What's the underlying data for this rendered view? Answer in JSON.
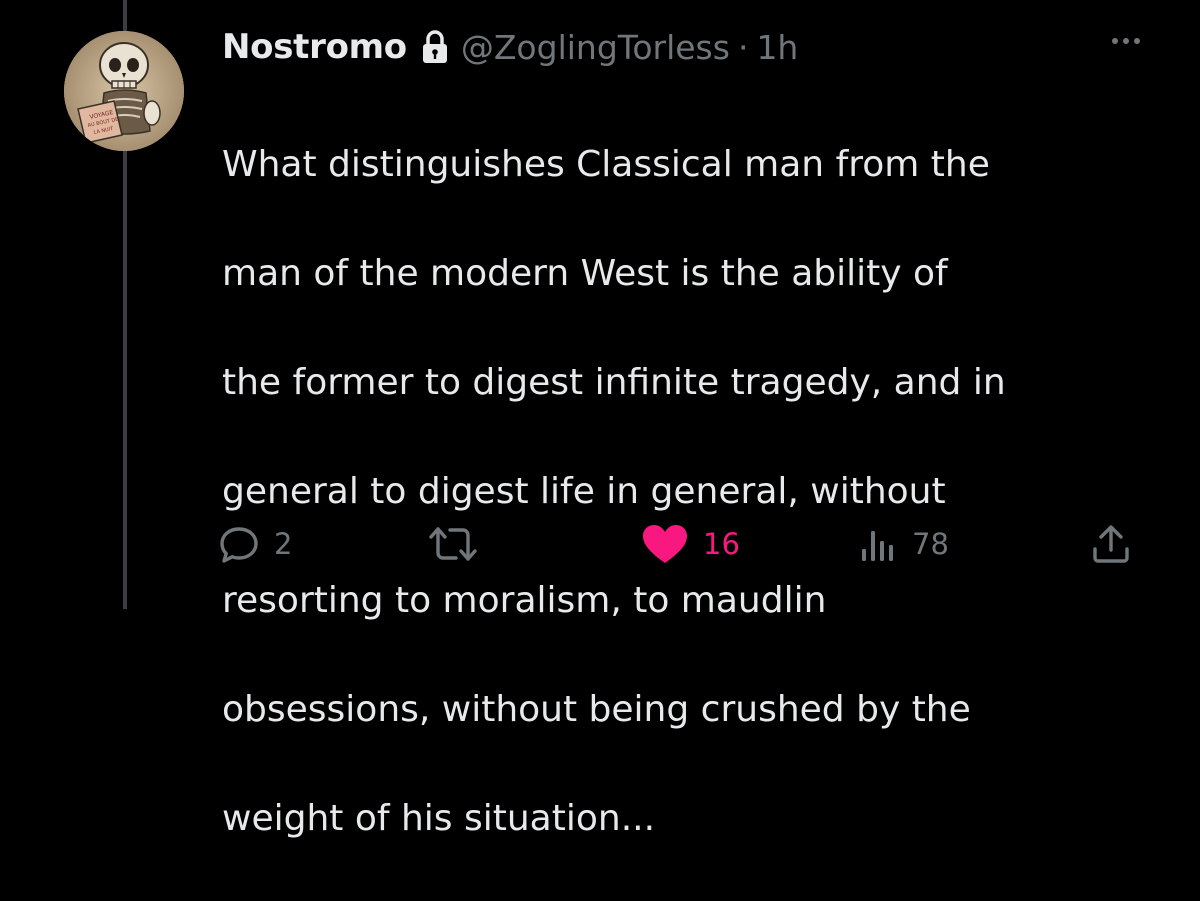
{
  "tweet": {
    "display_name": "Nostromo",
    "handle": "@ZoglingTorless",
    "separator": "·",
    "time": "1h",
    "text_lines": [
      "What distinguishes Classical man from the",
      "man of the modern West is the ability of",
      "the former to digest infinite tragedy, and in",
      "general to digest life in general, without",
      "resorting to moralism, to maudlin",
      "obsessions, without being crushed by the",
      "weight of his situation..."
    ]
  },
  "actions": {
    "reply": {
      "icon": "reply-icon",
      "count": "2"
    },
    "retweet": {
      "icon": "retweet-icon",
      "count": ""
    },
    "like": {
      "icon": "heart-filled-icon",
      "count": "16"
    },
    "views": {
      "icon": "views-chart-icon",
      "count": "78"
    },
    "share": {
      "icon": "share-icon"
    }
  },
  "avatar_text": [
    "VOYAGE",
    "AU BOUT DE",
    "LA NUIT"
  ],
  "colors": {
    "background": "#000000",
    "text": "#e7e9ea",
    "secondary": "#71767b",
    "like": "#f91880",
    "thread_line": "#3a3e42"
  }
}
